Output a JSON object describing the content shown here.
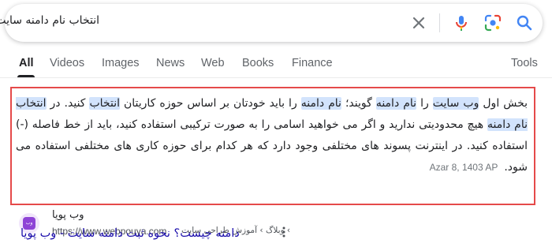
{
  "search": {
    "query": "انتخاب نام دامنه سایت"
  },
  "icons": {
    "clear": "close-icon",
    "voice": "microphone-icon",
    "lens": "camera-lens-icon",
    "search": "search-icon"
  },
  "tabs": [
    {
      "label": "All",
      "active": true
    },
    {
      "label": "Videos"
    },
    {
      "label": "Images"
    },
    {
      "label": "News"
    },
    {
      "label": "Web"
    },
    {
      "label": "Books"
    },
    {
      "label": "Finance"
    }
  ],
  "tools_label": "Tools",
  "snippet": {
    "segments": [
      "بخش اول ",
      "وب سایت",
      " را ",
      "نام دامنه",
      " گویند؛ ",
      "نام دامنه",
      " را باید خودتان بر اساس حوزه کاریتان ",
      "انتخاب",
      " کنید. در ",
      "انتخاب نام دامنه",
      " هیچ محدودیتی ندارید و اگر می خواهید اسامی را به صورت ترکیبی استفاده کنید، باید از خط فاصله (-) استفاده کنید. در اینترنت پسوند های مختلفی وجود دارد که هر کدام برای حوزه کاری های مختلفی استفاده می شود."
    ],
    "date": "Azar 8, 1403 AP"
  },
  "result": {
    "icon_text": "وب پویا",
    "site_name": "وب پویا",
    "url": "https://www.webpouya.com",
    "breadcrumb": "› وبلاگ › آموزش طراحی سایت",
    "title": "دامنه چیست؟ نحوه ثبت دامنه سایت - وب پویا"
  },
  "colors": {
    "highlight": "#d2e3fc",
    "snippet_border": "#e54a4a",
    "link": "#1a0dab",
    "google_blue": "#4285f4",
    "google_red": "#ea4335",
    "google_yellow": "#fbbc05",
    "google_green": "#34a853"
  }
}
